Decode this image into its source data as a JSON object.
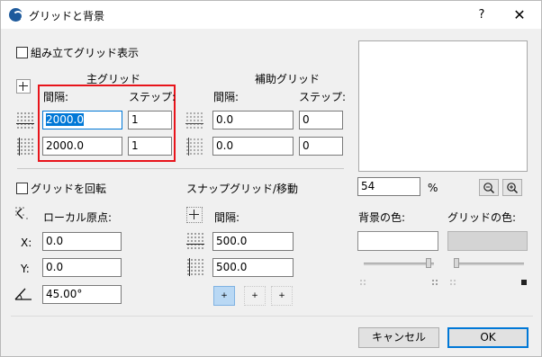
{
  "window": {
    "title": "グリッドと背景",
    "help_label": "?",
    "close_label": "✕"
  },
  "construction_grid_checkbox": {
    "label": "組み立てグリッド表示",
    "checked": false
  },
  "main_grid": {
    "heading": "主グリッド",
    "spacing_label": "間隔:",
    "step_label": "ステップ:",
    "h_spacing": "2000.0",
    "h_step": "1",
    "v_spacing": "2000.0",
    "v_step": "1"
  },
  "aux_grid": {
    "heading": "補助グリッド",
    "spacing_label": "間隔:",
    "step_label": "ステップ:",
    "h_spacing": "0.0",
    "h_step": "0",
    "v_spacing": "0.0",
    "v_step": "0"
  },
  "rotate": {
    "checkbox_label": "グリッドを回転",
    "checked": false,
    "local_origin_label": "ローカル原点:",
    "x_label": "X:",
    "x_value": "0.0",
    "y_label": "Y:",
    "y_value": "0.0",
    "angle_value": "45.00°"
  },
  "snap": {
    "heading": "スナップグリッド/移動",
    "spacing_label": "間隔:",
    "h_value": "500.0",
    "v_value": "500.0"
  },
  "zoom": {
    "value": "54",
    "unit": "%",
    "zoom_out_icon": "zoom-out-icon",
    "zoom_in_icon": "zoom-in-icon"
  },
  "colors": {
    "background_label": "背景の色:",
    "grid_label": "グリッドの色:",
    "background_color": "#ffffff",
    "grid_color": "#d4d4d4"
  },
  "buttons": {
    "cancel": "キャンセル",
    "ok": "OK"
  }
}
